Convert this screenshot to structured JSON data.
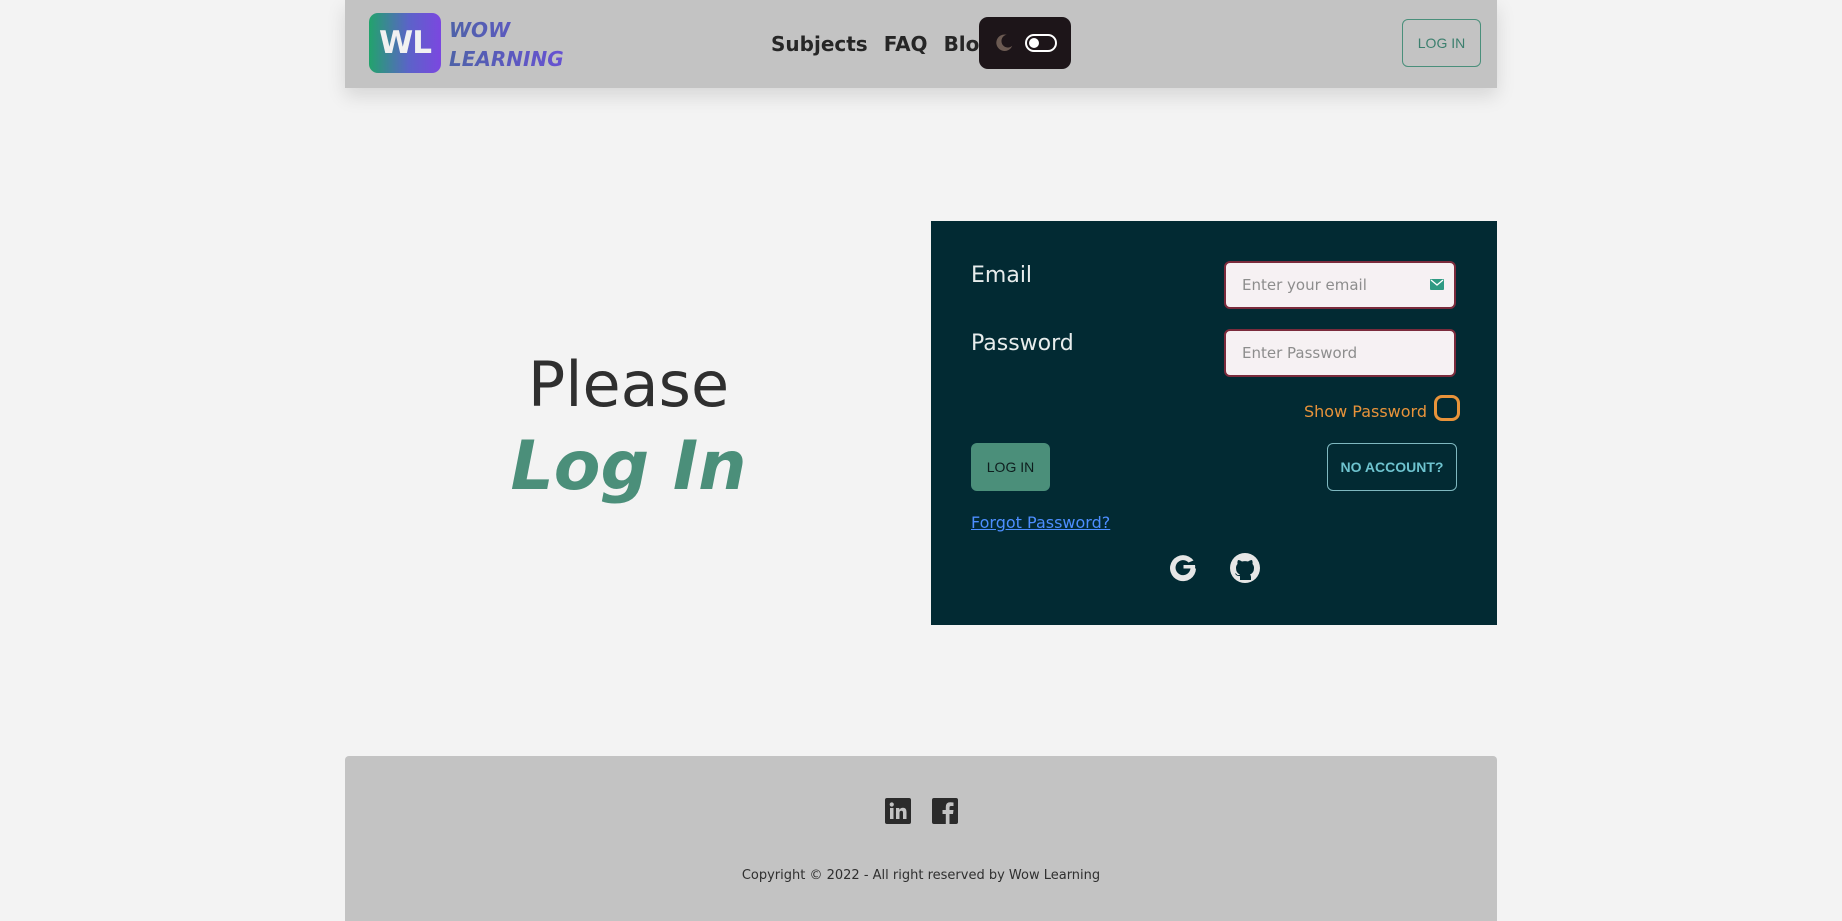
{
  "header": {
    "logo_badge": "WL",
    "logo_line1": "WOW",
    "logo_line2": "LEARNING",
    "nav": [
      {
        "label": "Subjects"
      },
      {
        "label": "FAQ"
      },
      {
        "label": "Blog"
      }
    ],
    "theme_toggle": {
      "icon": "moon-icon",
      "state": "dark-mode-off"
    },
    "login_label": "LOG IN"
  },
  "hero": {
    "line1": "Please",
    "line2": "Log In"
  },
  "form": {
    "email_label": "Email",
    "email_placeholder": "Enter your email",
    "email_value": "",
    "email_icon": "mail-icon",
    "password_label": "Password",
    "password_placeholder": "Enter Password",
    "password_value": "",
    "show_password_label": "Show Password",
    "show_password_checked": false,
    "login_button": "LOG IN",
    "no_account_button": "NO ACCOUNT?",
    "forgot_link": "Forgot Password?",
    "social": [
      "google-icon",
      "github-icon"
    ]
  },
  "footer": {
    "social": [
      "linkedin-icon",
      "facebook-icon"
    ],
    "copyright": "Copyright © 2022 - All right reserved by Wow Learning"
  },
  "colors": {
    "page_bg": "#f3f3f3",
    "header_bg": "#c3c3c3",
    "panel_bg": "#022a33",
    "accent_green": "#4b8f7a",
    "accent_orange": "#e8933a",
    "link_blue": "#4d8eff",
    "secondary_cyan": "#6ec3cf"
  }
}
